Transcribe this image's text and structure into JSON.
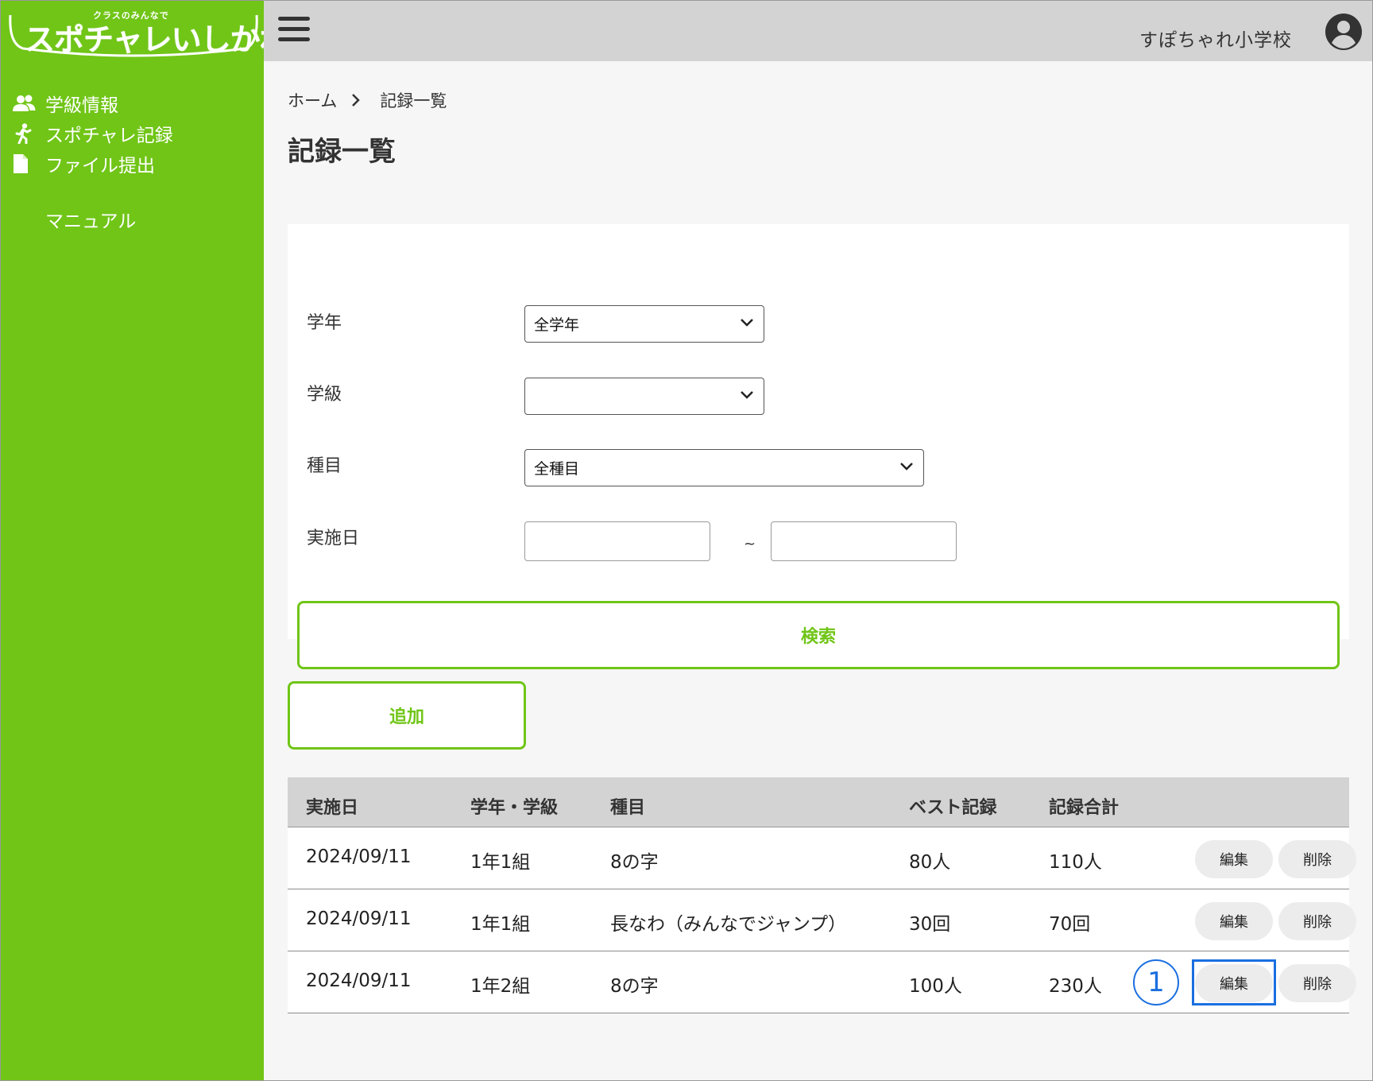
{
  "brand": {
    "tagline": "クラスのみんなで",
    "name": "スポチャレいしかわ"
  },
  "sidebar": {
    "items": [
      {
        "label": "学級情報",
        "icon": "users-icon"
      },
      {
        "label": "スポチャレ記録",
        "icon": "running-person-icon"
      },
      {
        "label": "ファイル提出",
        "icon": "file-icon"
      }
    ],
    "manual_label": "マニュアル"
  },
  "header": {
    "school_name": "すぽちゃれ小学校"
  },
  "breadcrumb": {
    "home": "ホーム",
    "current": "記録一覧"
  },
  "page": {
    "title": "記録一覧"
  },
  "search": {
    "grade_label": "学年",
    "grade_value": "全学年",
    "class_label": "学級",
    "class_value": "",
    "event_label": "種目",
    "event_value": "全種目",
    "date_label": "実施日",
    "date_separator": "~",
    "button_label": "検索"
  },
  "add_button_label": "追加",
  "table": {
    "headers": [
      "実施日",
      "学年・学級",
      "種目",
      "ベスト記録",
      "記録合計"
    ],
    "edit_label": "編集",
    "delete_label": "削除",
    "rows": [
      {
        "date": "2024/09/11",
        "class": "1年1組",
        "event": "8の字",
        "best": "80人",
        "total": "110人"
      },
      {
        "date": "2024/09/11",
        "class": "1年1組",
        "event": "長なわ（みんなでジャンプ）",
        "best": "30回",
        "total": "70回"
      },
      {
        "date": "2024/09/11",
        "class": "1年2組",
        "event": "8の字",
        "best": "100人",
        "total": "230人"
      }
    ]
  },
  "annotation": {
    "marker_label": "1",
    "color": "#1a6fe0"
  },
  "colors": {
    "brand_green": "#70c517",
    "header_gray": "#d3d3d3"
  }
}
